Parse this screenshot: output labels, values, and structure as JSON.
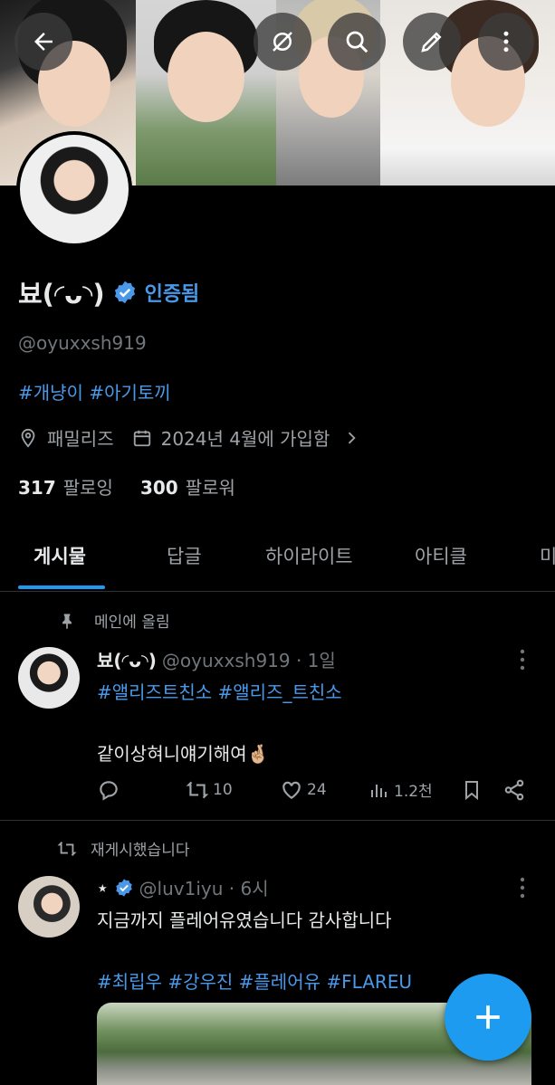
{
  "profile": {
    "name": "뵤(◜ᴗ◝)",
    "verified_label": "인증됨",
    "handle": "@oyuxxsh919",
    "bio_hashtags": "#개냥이 #아기토끼",
    "location": "패밀리즈",
    "joined": "2024년 4월에 가입함",
    "following_count": "317",
    "following_label": "팔로잉",
    "followers_count": "300",
    "followers_label": "팔로워"
  },
  "header": {
    "icons": [
      "back-arrow-icon",
      "no-sync-icon",
      "search-icon",
      "edit-icon",
      "more-vertical-icon"
    ]
  },
  "tabs": [
    {
      "label": "게시물",
      "active": true
    },
    {
      "label": "답글"
    },
    {
      "label": "하이라이트"
    },
    {
      "label": "아티클"
    },
    {
      "label": "미"
    }
  ],
  "posts": [
    {
      "context": "메인에 올림",
      "name": "뵤(◜ᴗ◝)",
      "handle_time": "@oyuxxsh919 · 1일",
      "tags": "#앨리즈트친소 #앨리즈_트친소",
      "text": "같이상혀니얘기해여🤞🏼",
      "retweets": "10",
      "likes": "24",
      "views": "1.2천"
    },
    {
      "context": "재게시했습니다",
      "name": "⋆",
      "handle_time": "@luv1iyu · 6시",
      "text": "지금까지 플레어유였습니다 감사합니다",
      "tags": "#최립우 #강우진 #플레어유 #FLAREU"
    }
  ],
  "colors": {
    "accent": "#1d9bf0",
    "link": "#4a99e9",
    "background": "#000000",
    "muted": "#71767b"
  }
}
